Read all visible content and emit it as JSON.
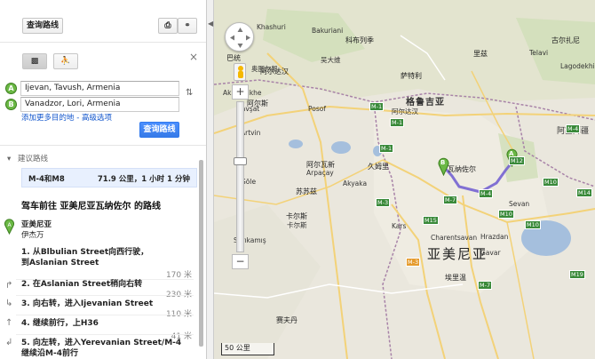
{
  "panel": {
    "get_directions_top": "查询路线",
    "print_icon": "printer-icon",
    "link_icon": "link-icon",
    "close_icon": "close-icon",
    "mode_car_icon": "car-icon",
    "mode_walk_icon": "walk-icon",
    "origin_marker": "A",
    "origin_value": "Ijevan, Tavush, Armenia",
    "dest_marker": "B",
    "dest_value": "Vanadzor, Lori, Armenia",
    "swap_icon": "swap-icon",
    "add_dest_link": "添加更多目的地",
    "options_link": "高级选项",
    "link_sep": " - ",
    "get_directions_btn": "查询路线",
    "suggested_label": "建议路线",
    "route_name": "M-4和M8",
    "route_summary": "71.9 公里，1 小时 1 分钟",
    "heading": "驾车前往 亚美尼亚瓦纳佐尔 的路线",
    "start_country": "亚美尼亚",
    "start_city": "伊杰万",
    "steps": [
      {
        "line1": "1. 从Blbulian Street向西行驶，",
        "line2": "到Aslanian Street",
        "dist": "170 米"
      },
      {
        "line1": "2. 在Aslanian Street稍向右转",
        "line2": "",
        "dist": "230 米"
      },
      {
        "line1": "3. 向右转，进入Ijevanian Street",
        "line2": "",
        "dist": "110 米"
      },
      {
        "line1": "4. 继续前行，上H36",
        "line2": "",
        "dist": "41 米"
      },
      {
        "line1": "5. 向左转，进入Yerevanian Street/M-4",
        "line2": "继续沿M-4前行",
        "dist": ""
      }
    ]
  },
  "map": {
    "scale": "50 公里",
    "marker_a": "A",
    "marker_b": "B",
    "country_labels": [
      "格鲁吉亚",
      "亚美尼亚",
      "阿塞拜疆"
    ],
    "cities": [
      {
        "name": "久姆里"
      },
      {
        "name": "瓦纳佐尔"
      },
      {
        "name": "卡尔斯"
      },
      {
        "name": "阿尔瓦新"
      },
      {
        "name": "阿尔斯"
      },
      {
        "name": "古尔扎尼"
      },
      {
        "name": "巴统"
      },
      {
        "name": "苏苏兹"
      },
      {
        "name": "埃里温"
      },
      {
        "name": "阿尔达汉"
      },
      {
        "name": "科布列季"
      },
      {
        "name": "萨特利"
      },
      {
        "name": "赛夫丹"
      },
      {
        "name": "里兹"
      }
    ],
    "small_labels": [
      "奥图尔凯",
      "吴大维",
      "阿尔达汉",
      "Khashuri",
      "Akhaltsikhe",
      "卡尔斯",
      "Kars",
      "Sarıkamış",
      "Arpaçay",
      "Akyaka",
      "Charentsavan",
      "Gavar",
      "Sevan",
      "Bakuriani",
      "Hrazdan",
      "Göle",
      "Şavşat",
      "Artvin",
      "Posof",
      "Lagodekhi",
      "Telavi"
    ],
    "highways": [
      "M-1",
      "M-4",
      "M10",
      "M14",
      "M10",
      "M-3",
      "M-7",
      "M12",
      "M19",
      "M-7",
      "M15",
      "M-1",
      "M-1",
      "M10",
      "M-3",
      "M-4"
    ],
    "zoom_in": "+",
    "zoom_out": "−",
    "pan_icon": "pan-control-icon",
    "pegman_icon": "pegman-icon"
  }
}
